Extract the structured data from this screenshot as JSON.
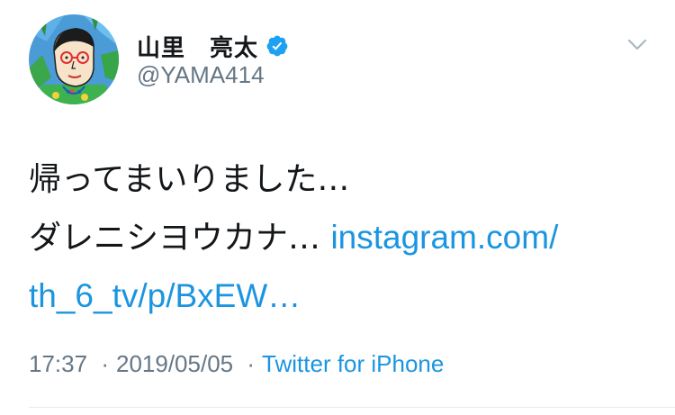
{
  "user": {
    "display_name": "山里　亮太",
    "handle": "@YAMA414",
    "verified_icon": "verified-badge-icon",
    "avatar": "avatar-illustration"
  },
  "tweet": {
    "line1": "帰ってまいりました…",
    "line2_text": "ダレニシヨウカナ… ",
    "link_part1": "instagram.com/",
    "link_part2": "th_6_tv/p/BxEW…"
  },
  "meta": {
    "time": "17:37",
    "separator": "·",
    "date": "2019/05/05",
    "source": "Twitter for iPhone"
  },
  "icons": {
    "caret": "chevron-down-icon"
  },
  "colors": {
    "link": "#1b95e0",
    "secondary_text": "#657786",
    "verified": "#1da1f2"
  }
}
